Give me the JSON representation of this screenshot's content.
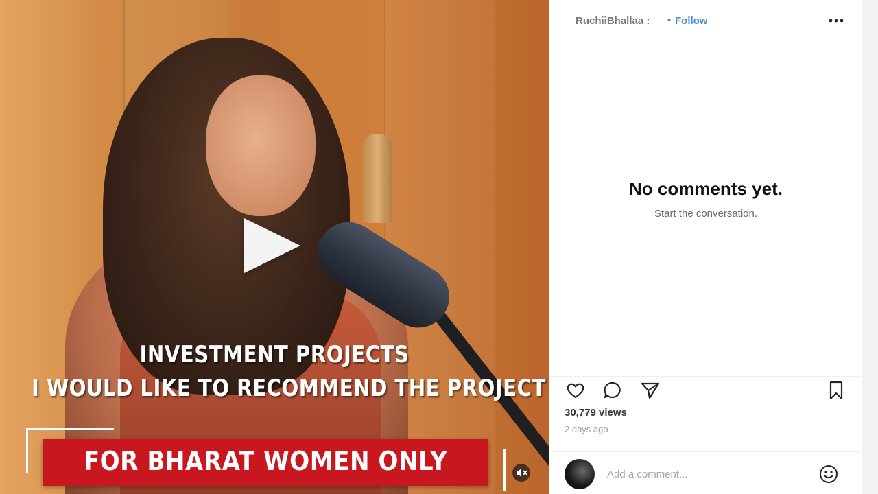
{
  "video": {
    "caption_line_1": "INVESTMENT PROJECTS",
    "caption_line_2": "I WOULD LIKE TO RECOMMEND THE PROJECT",
    "banner_text": "FOR  BHARAT WOMEN ONLY",
    "banner_color": "#c8171e",
    "play_icon": "play-icon",
    "mute_icon": "muted-speaker-icon"
  },
  "header": {
    "username": "RuchiiBhallaa :",
    "separator": "•",
    "follow_label": "Follow",
    "follow_color": "#4a8fd6",
    "more_icon": "more-options-icon"
  },
  "comments": {
    "empty_title": "No comments yet.",
    "empty_subtitle": "Start the conversation."
  },
  "actions": {
    "like_icon": "heart-icon",
    "comment_icon": "comment-bubble-icon",
    "share_icon": "send-paper-plane-icon",
    "save_icon": "bookmark-icon"
  },
  "stats": {
    "views": "30,779 views",
    "posted": "2 days ago"
  },
  "comment_box": {
    "placeholder": "Add a comment...",
    "emoji_icon": "smiley-icon"
  }
}
